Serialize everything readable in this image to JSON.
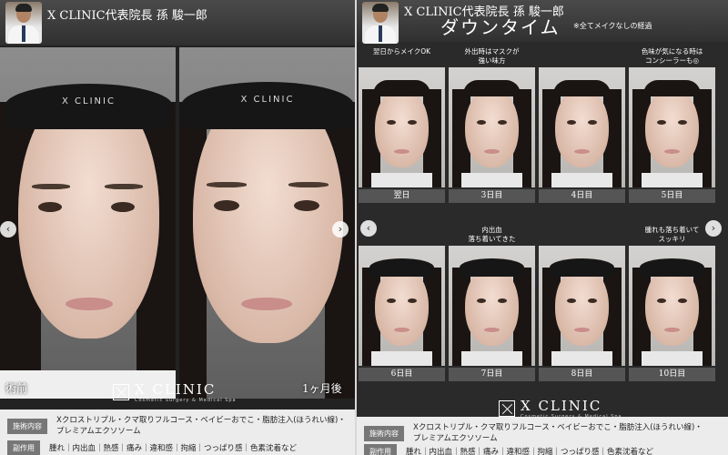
{
  "left": {
    "header_title": "X CLINIC代表院長 孫 駿一郎",
    "before_label": "術前",
    "after_label": "1ヶ月後",
    "headband_text": "X CLINIC",
    "logo": {
      "name": "X CLINIC",
      "sub": "Cosmetic Surgery & Medical Spa"
    },
    "prev_arrow": "‹",
    "next_arrow": "›",
    "treatment_tag": "施術内容",
    "treatment_text_1": "Xクロストリプル・クマ取りフルコース・ベイビーおでこ・脂肪注入(ほうれい線)・",
    "treatment_text_2": "プレミアムエクソソーム",
    "side_effect_tag": "副作用",
    "side_effect_text": "腫れ｜内出血｜熱感｜痛み｜違和感｜拘縮｜つっぱり感｜色素沈着など"
  },
  "right": {
    "header_title": "X CLINIC代表院長 孫 駿一郎",
    "title": "ダウンタイム",
    "note": "※全てメイクなしの経過",
    "prev_arrow": "‹",
    "next_arrow": "›",
    "logo": {
      "name": "X CLINIC",
      "sub": "Cosmetic Surgery & Medical Spa"
    },
    "treatment_tag": "施術内容",
    "treatment_text_1": "Xクロストリプル・クマ取りフルコース・ベイビーおでこ・脂肪注入(ほうれい線)・",
    "treatment_text_2": "プレミアムエクソソーム",
    "side_effect_tag": "副作用",
    "side_effect_text": "腫れ｜内出血｜熱感｜痛み｜違和感｜拘縮｜つっぱり感｜色素沈着など",
    "days": [
      {
        "note1": "翌日からメイクOK",
        "note2": "",
        "label": "翌日"
      },
      {
        "note1": "外出時はマスクが",
        "note2": "強い味方",
        "label": "3日目"
      },
      {
        "note1": "",
        "note2": "",
        "label": "4日目"
      },
      {
        "note1": "色味が気になる時は",
        "note2": "コンシーラーも◎",
        "label": "5日目"
      },
      {
        "note1": "",
        "note2": "",
        "label": "6日目"
      },
      {
        "note1": "内出血",
        "note2": "落ち着いてきた",
        "label": "7日目"
      },
      {
        "note1": "",
        "note2": "",
        "label": "8日目"
      },
      {
        "note1": "腫れも落ち着いて",
        "note2": "スッキリ",
        "label": "10日目"
      }
    ]
  },
  "colors": {
    "tag_bg": "#777777",
    "info_bg": "#ececec",
    "day_label_bg": "#555555"
  }
}
